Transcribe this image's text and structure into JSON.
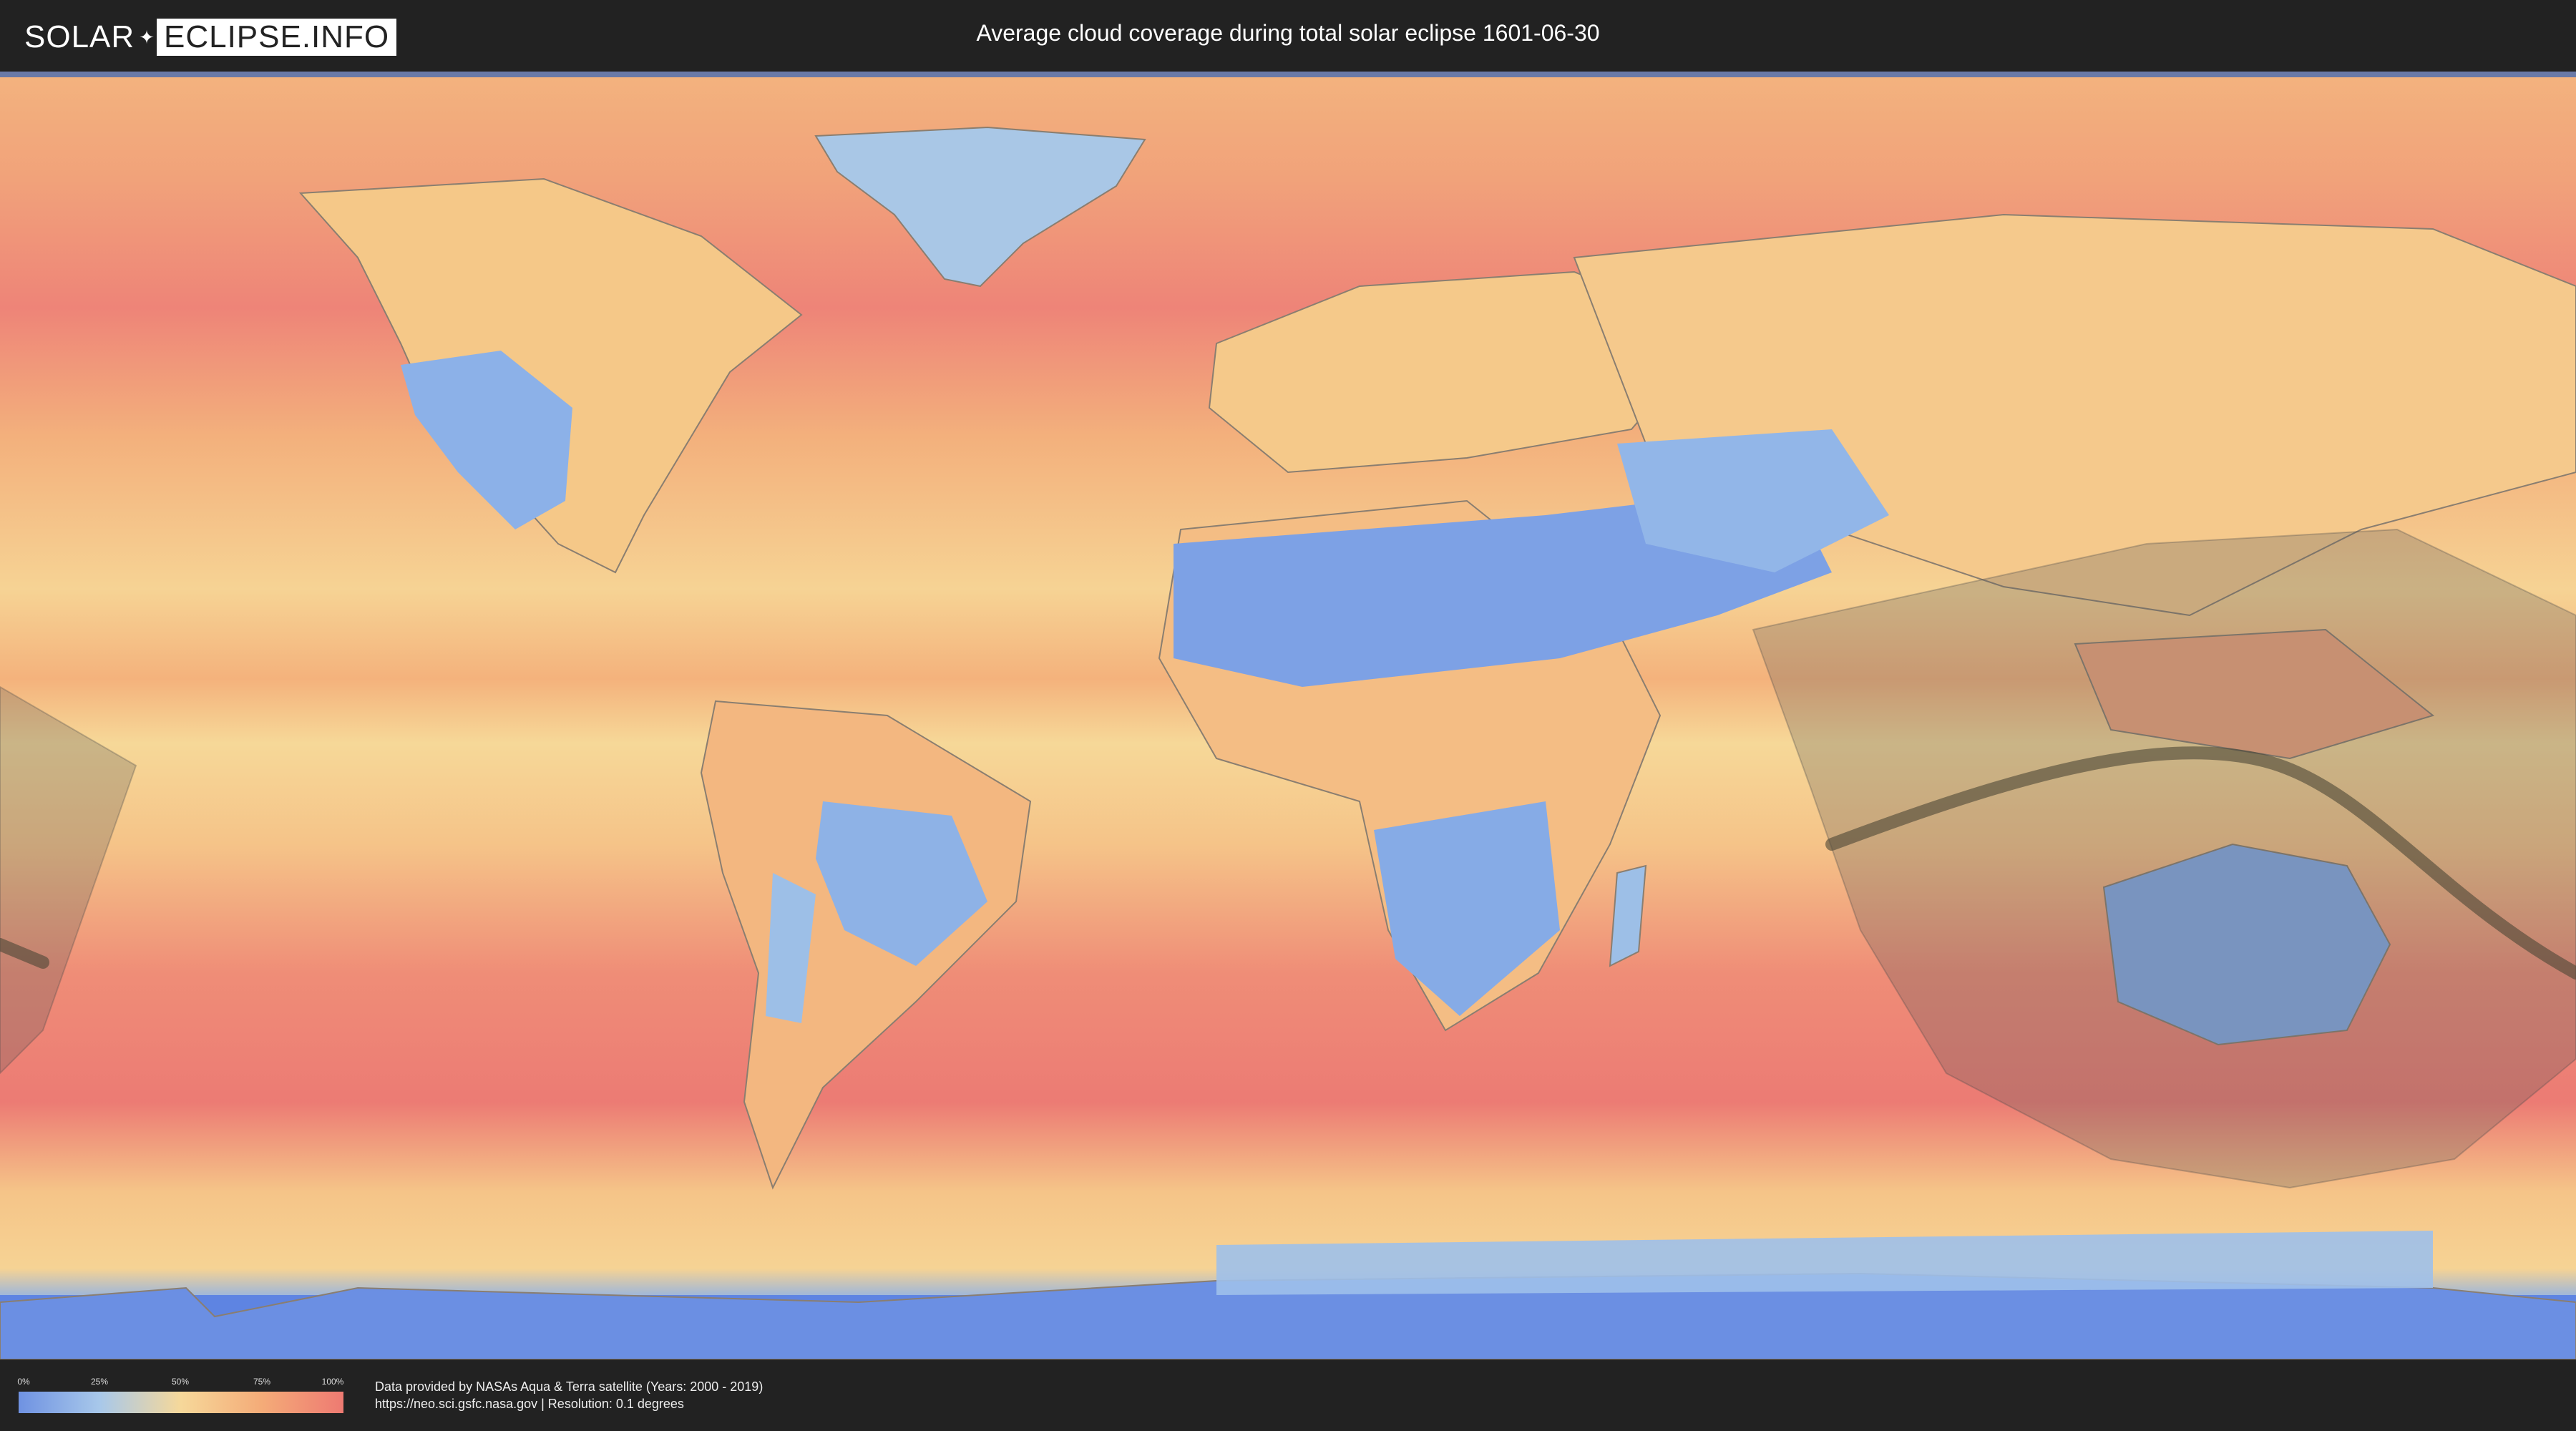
{
  "header": {
    "logo_part1": "SOLAR",
    "logo_part2": "ECLIPSE.INFO",
    "title": "Average cloud coverage during total solar eclipse 1601-06-30"
  },
  "map": {
    "layer": "average cloud coverage",
    "projection": "equirectangular",
    "features": [
      "eclipse-visibility-zone",
      "totality-path"
    ],
    "colors": {
      "clear": "#6f92e2",
      "low": "#a8c8ea",
      "mid": "#f6d89a",
      "high": "#f4ab78",
      "overcast": "#ee7a72",
      "visibility_shade": "#5a5a5a",
      "totality_path": "#4a4a3a"
    }
  },
  "legend": {
    "ticks": [
      "0%",
      "25%",
      "50%",
      "75%",
      "100%"
    ],
    "tick_fractions": [
      0,
      0.25,
      0.5,
      0.75,
      1
    ]
  },
  "footer": {
    "line1": "Data provided by NASAs Aqua & Terra satellite (Years: 2000 - 2019)",
    "line2": "https://neo.sci.gsfc.nasa.gov | Resolution: 0.1 degrees"
  }
}
